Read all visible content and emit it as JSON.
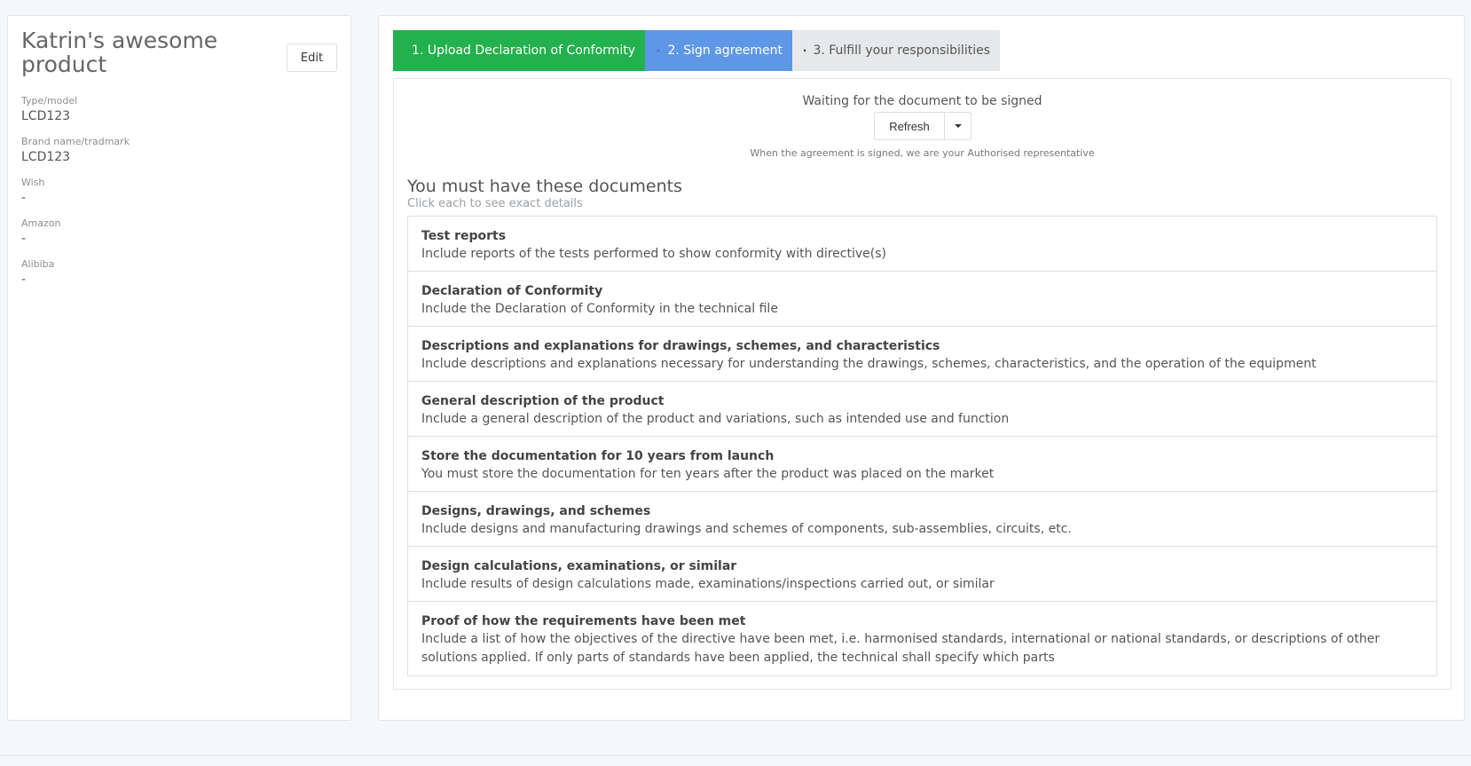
{
  "product": {
    "title": "Katrin's awesome product",
    "edit_label": "Edit",
    "fields": [
      {
        "label": "Type/model",
        "value": "LCD123"
      },
      {
        "label": "Brand name/tradmark",
        "value": "LCD123"
      },
      {
        "label": "Wish",
        "value": "-"
      },
      {
        "label": "Amazon",
        "value": "-"
      },
      {
        "label": "Alibiba",
        "value": "-"
      }
    ]
  },
  "steps": [
    {
      "label": "1. Upload Declaration of Conformity",
      "icon": "document-icon",
      "color": "#22b14c",
      "state": "completed"
    },
    {
      "label": "2. Sign agreement",
      "icon": "double-check-icon",
      "color": "#5d97e6",
      "state": "active"
    },
    {
      "label": "3. Fulfill your responsibilities",
      "icon": "shield-check-icon",
      "color": "#e6e8ea",
      "state": "pending"
    }
  ],
  "agreement": {
    "status": "Waiting for the document to be signed",
    "refresh_label": "Refresh",
    "note": "When the agreement is signed, we are your Authorised representative"
  },
  "documents": {
    "title": "You must have these documents",
    "subtitle": "Click each to see exact details",
    "items": [
      {
        "title": "Test reports",
        "description": "Include reports of the tests performed to show conformity with directive(s)"
      },
      {
        "title": "Declaration of Conformity",
        "description": "Include the Declaration of Conformity in the technical file"
      },
      {
        "title": "Descriptions and explanations for drawings, schemes, and characteristics",
        "description": "Include descriptions and explanations necessary for understanding the drawings, schemes, characteristics, and the operation of the equipment"
      },
      {
        "title": "General description of the product",
        "description": "Include a general description of the product and variations, such as intended use and function"
      },
      {
        "title": "Store the documentation for 10 years from launch",
        "description": "You must store the documentation for ten years after the product was placed on the market"
      },
      {
        "title": "Designs, drawings, and schemes",
        "description": "Include designs and manufacturing drawings and schemes of components, sub-assemblies, circuits, etc."
      },
      {
        "title": "Design calculations, examinations, or similar",
        "description": "Include results of design calculations made, examinations/inspections carried out, or similar"
      },
      {
        "title": "Proof of how the requirements have been met",
        "description": "Include a list of how the objectives of the directive have been met, i.e. harmonised standards, international or national standards, or descriptions of other solutions applied. If only parts of standards have been applied, the technical shall specify which parts"
      }
    ]
  }
}
